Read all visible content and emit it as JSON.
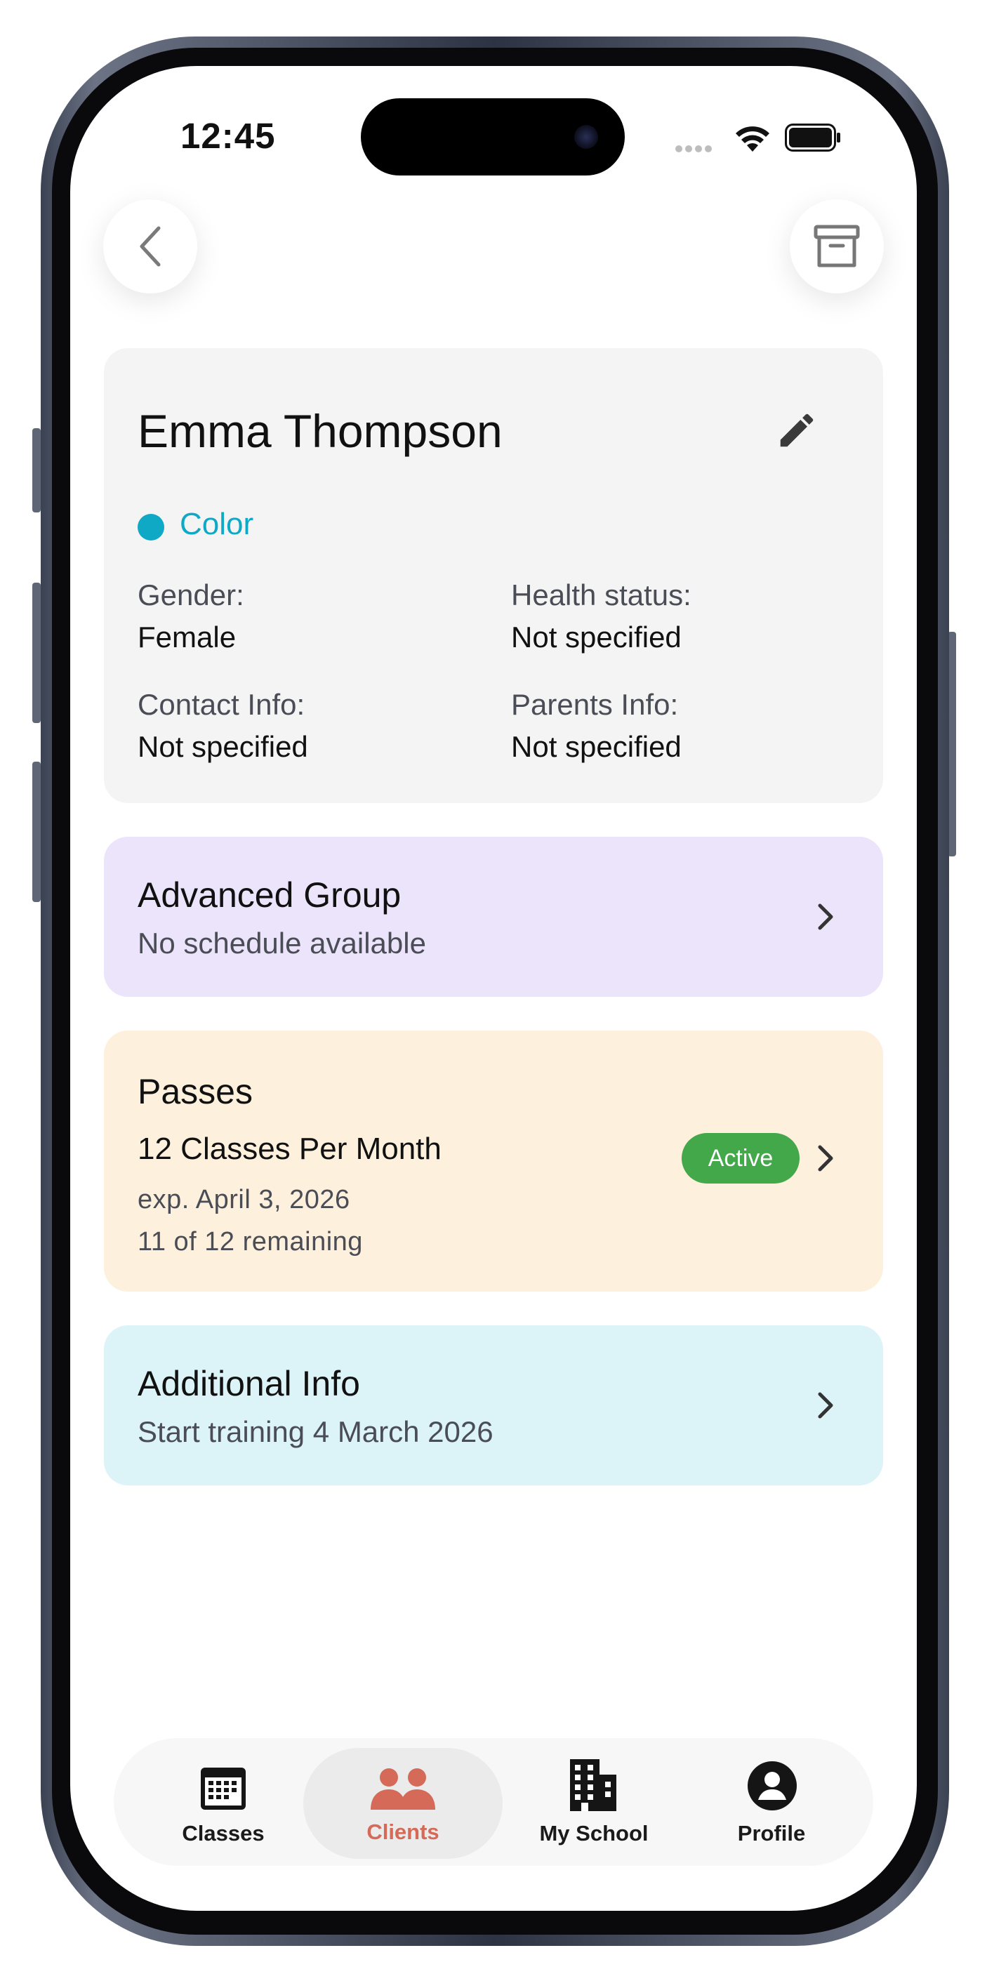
{
  "status_bar": {
    "time": "12:45"
  },
  "header": {
    "back_icon": "chevron-left-icon",
    "archive_icon": "archive-icon"
  },
  "client": {
    "name": "Emma Thompson",
    "edit_icon": "pencil-icon",
    "color_label": "Color",
    "color_value": "#0fa8c5",
    "fields": [
      {
        "label": "Gender:",
        "value": "Female"
      },
      {
        "label": "Health status:",
        "value": "Not specified"
      },
      {
        "label": "Contact Info:",
        "value": "Not specified"
      },
      {
        "label": "Parents Info:",
        "value": "Not specified"
      }
    ]
  },
  "group": {
    "title": "Advanced Group",
    "subtitle": "No schedule available",
    "bg_color": "#ece4fb"
  },
  "passes": {
    "title": "Passes",
    "pass_name": "12 Classes Per Month",
    "expiry": "exp. April 3, 2026",
    "remaining": "11 of 12 remaining",
    "status": "Active",
    "status_color": "#43a84a",
    "bg_color": "#fdf0dd"
  },
  "additional": {
    "title": "Additional Info",
    "subtitle": "Start training 4 March 2026",
    "bg_color": "#dcf4f7"
  },
  "nav": {
    "items": [
      {
        "label": "Classes",
        "icon": "calendar-icon"
      },
      {
        "label": "Clients",
        "icon": "people-icon",
        "active": true
      },
      {
        "label": "My School",
        "icon": "building-icon"
      },
      {
        "label": "Profile",
        "icon": "account-circle-icon"
      }
    ],
    "active_color": "#d46a57"
  }
}
